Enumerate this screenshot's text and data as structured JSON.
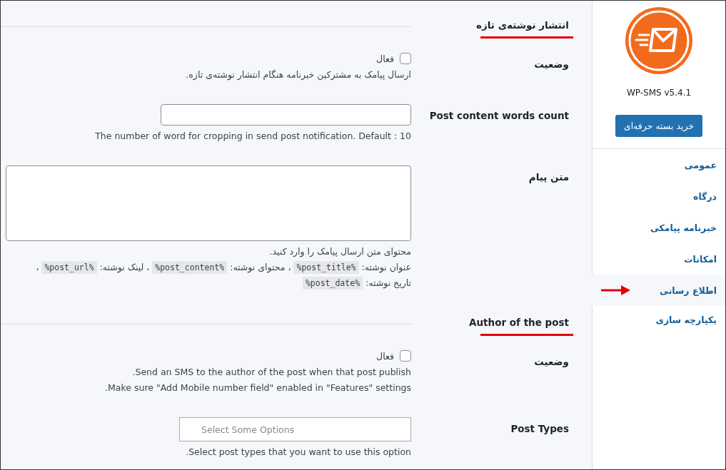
{
  "sidebar": {
    "version": "WP-SMS v5.4.1",
    "buy_button": "خرید بسته حرفه‌ای",
    "items": [
      {
        "label": "عمومی",
        "selected": false
      },
      {
        "label": "درگاه",
        "selected": false
      },
      {
        "label": "خبرنامه پیامکی",
        "selected": false
      },
      {
        "label": "امکانات",
        "selected": false
      },
      {
        "label": "اطلاع رسانی",
        "selected": true
      },
      {
        "label": "یکپارچه سازی",
        "selected": false
      }
    ]
  },
  "sections": [
    {
      "title": "انتشار نوشته‌ی تازه",
      "rows": [
        {
          "kind": "checkbox",
          "label": "وضعیت",
          "checkbox_label": "فعال",
          "checked": false,
          "description": [
            [
              {
                "text": "ارسال پیامک به مشترکین خبرنامه هنگام انتشار نوشته‌ی تازه."
              }
            ]
          ]
        },
        {
          "kind": "text",
          "label": "Post content words count",
          "description": [
            [
              {
                "text": "The number of word for cropping in send post notification. Default : 10"
              }
            ]
          ]
        },
        {
          "kind": "textarea",
          "label": "متن پیام",
          "description": [
            [
              {
                "text": "محتوای متن ارسال پیامک را وارد کنید."
              }
            ],
            [
              {
                "text": "عنوان نوشته: "
              },
              {
                "code": "%post_title%"
              },
              {
                "text": " ، محتوای نوشته: "
              },
              {
                "code": "%post_content%"
              },
              {
                "text": " ، لینک نوشته: "
              },
              {
                "code": "%post_url%"
              },
              {
                "text": " ،"
              }
            ],
            [
              {
                "text": "تاریخ نوشته: "
              },
              {
                "code": "%post_date%"
              }
            ]
          ]
        }
      ]
    },
    {
      "title": "Author of the post",
      "rows": [
        {
          "kind": "checkbox",
          "label": "وضعیت",
          "checkbox_label": "فعال",
          "checked": false,
          "description": [
            [
              {
                "text": "Send an SMS to the author of the post when that post publish."
              }
            ],
            [
              {
                "text": "Make sure \"Add Mobile number field\" enabled in \"Features\" settings."
              }
            ]
          ]
        },
        {
          "kind": "select",
          "label": "Post Types",
          "placeholder": "Select Some Options",
          "description": [
            [
              {
                "text": "Select post types that you want to use this option."
              }
            ]
          ]
        }
      ]
    }
  ]
}
